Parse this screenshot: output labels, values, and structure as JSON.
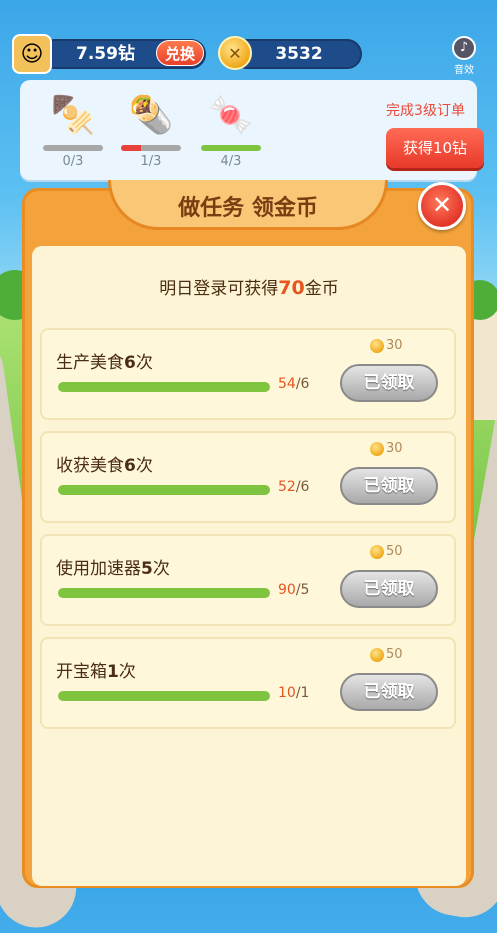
{
  "top_bar": {
    "diamond_balance": "7.59钻",
    "exchange_label": "兑换",
    "coin_balance": "3532",
    "sound_label": "音效"
  },
  "order": {
    "foods": [
      {
        "icon": "kebab-icon",
        "count": "0/3",
        "progress": 0.0,
        "color": "#a7a7a7"
      },
      {
        "icon": "burrito-icon",
        "count": "1/3",
        "progress": 0.333,
        "color": "#e8403a"
      },
      {
        "icon": "candy-icon",
        "count": "4/3",
        "progress": 1.0,
        "color": "#7fc43f"
      }
    ],
    "title": "完成3级订单",
    "button_label": "获得10钻"
  },
  "task_panel": {
    "title": "做任务 领金币",
    "login_prefix": "明日登录可获得",
    "login_amount": "70",
    "login_suffix": "金币",
    "tasks": [
      {
        "name": "生产美食",
        "num": "6",
        "unit": "次",
        "progress_cur": "54",
        "progress_total": "/6",
        "reward": "30",
        "button": "已领取",
        "fill": 1.0
      },
      {
        "name": "收获美食",
        "num": "6",
        "unit": "次",
        "progress_cur": "52",
        "progress_total": "/6",
        "reward": "30",
        "button": "已领取",
        "fill": 1.0
      },
      {
        "name": "使用加速器",
        "num": "5",
        "unit": "次",
        "progress_cur": "90",
        "progress_total": "/5",
        "reward": "50",
        "button": "已领取",
        "fill": 1.0
      },
      {
        "name": "开宝箱",
        "num": "1",
        "unit": "次",
        "progress_cur": "10",
        "progress_total": "/1",
        "reward": "50",
        "button": "已领取",
        "fill": 1.0
      }
    ]
  },
  "colors": {
    "accent_red": "#e8392a",
    "progress_green": "#7fc43f",
    "panel_orange": "#f4a33c"
  }
}
